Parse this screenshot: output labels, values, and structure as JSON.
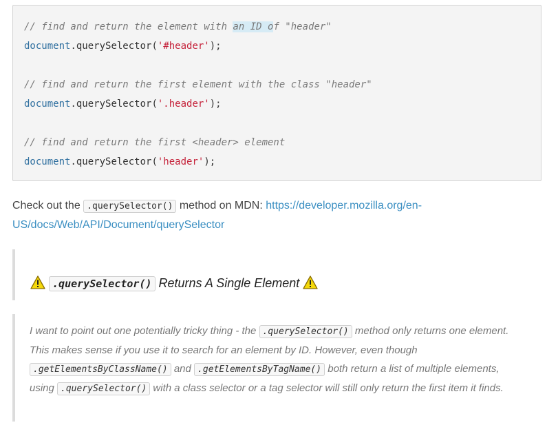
{
  "code_block": {
    "comment1_a": "// find and return the element with ",
    "comment1_hl": "an ID o",
    "comment1_b": "f \"header\"",
    "line1_obj": "document",
    "line1_method": ".querySelector(",
    "line1_str": "'#header'",
    "line1_end": ");",
    "comment2": "// find and return the first element with the class \"header\"",
    "line2_obj": "document",
    "line2_method": ".querySelector(",
    "line2_str": "'.header'",
    "line2_end": ");",
    "comment3": "// find and return the first <header> element",
    "line3_obj": "document",
    "line3_method": ".querySelector(",
    "line3_str": "'header'",
    "line3_end": ");"
  },
  "mdn_paragraph": {
    "prefix": "Check out the ",
    "code": ".querySelector()",
    "middle": " method on MDN: ",
    "link_text": "https://developer.mozilla.org/en-US/docs/Web/API/Document/querySelector"
  },
  "callout_heading": {
    "code": ".querySelector()",
    "text": " Returns A Single Element "
  },
  "callout_body": {
    "t1": "I want to point out one potentially tricky thing - the ",
    "c1": ".querySelector()",
    "t2": " method only returns one element. This makes sense if you use it to search for an element by ID. However, even though ",
    "c2": ".getElementsByClassName()",
    "t3": " and ",
    "c3": ".getElementsByTagName()",
    "t4": " both return a list of multiple elements, using ",
    "c4": ".querySelector()",
    "t5": " with a class selector or a tag selector will still only return the first item it finds."
  },
  "icons": {
    "warning": "warning-icon"
  },
  "colors": {
    "link": "#3b8fc2",
    "string": "#c5223a",
    "object": "#2f6f9f",
    "warning_fill": "#f5d90a"
  }
}
